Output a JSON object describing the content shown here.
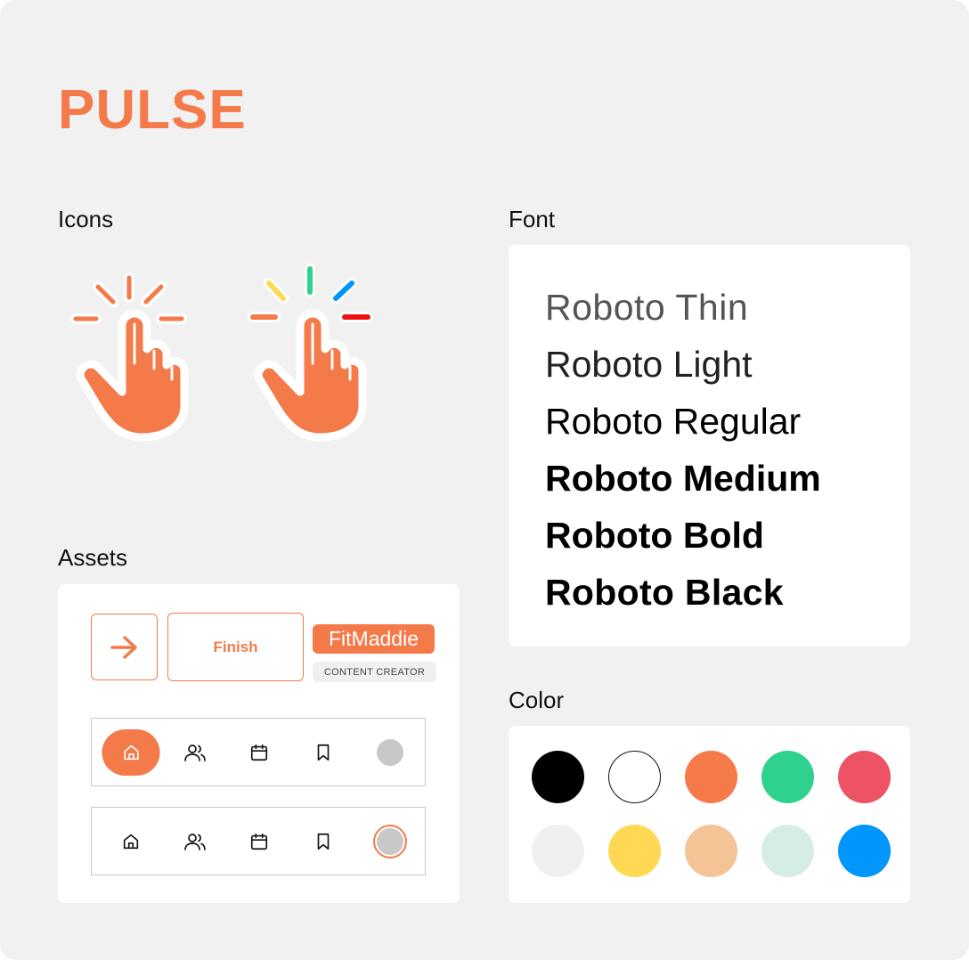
{
  "title": "PULSE",
  "sections": {
    "icons": "Icons",
    "font": "Font",
    "assets": "Assets",
    "color": "Color"
  },
  "icons": [
    {
      "name": "tap-hand-icon",
      "variant": "orange-rays"
    },
    {
      "name": "tap-hand-icon",
      "variant": "multicolor-rays"
    }
  ],
  "fonts": [
    "Roboto Thin",
    "Roboto Light",
    "Roboto Regular",
    "Roboto Medium",
    "Roboto Bold",
    "Roboto Black"
  ],
  "assets": {
    "arrow_button_icon": "arrow-right-icon",
    "finish_label": "Finish",
    "name_tag": "FitMaddie",
    "role_tag": "CONTENT CREATOR",
    "nav_icons": [
      "home-icon",
      "users-icon",
      "calendar-icon",
      "bookmark-icon",
      "avatar"
    ]
  },
  "colors": {
    "accent": "#f47a4a",
    "swatches": [
      "#000000",
      "#ffffff",
      "#f47a4a",
      "#2fd18e",
      "#ee5265",
      "#f0f0f0",
      "#ffd954",
      "#f4c496",
      "#d6ede3",
      "#0096fc"
    ]
  }
}
